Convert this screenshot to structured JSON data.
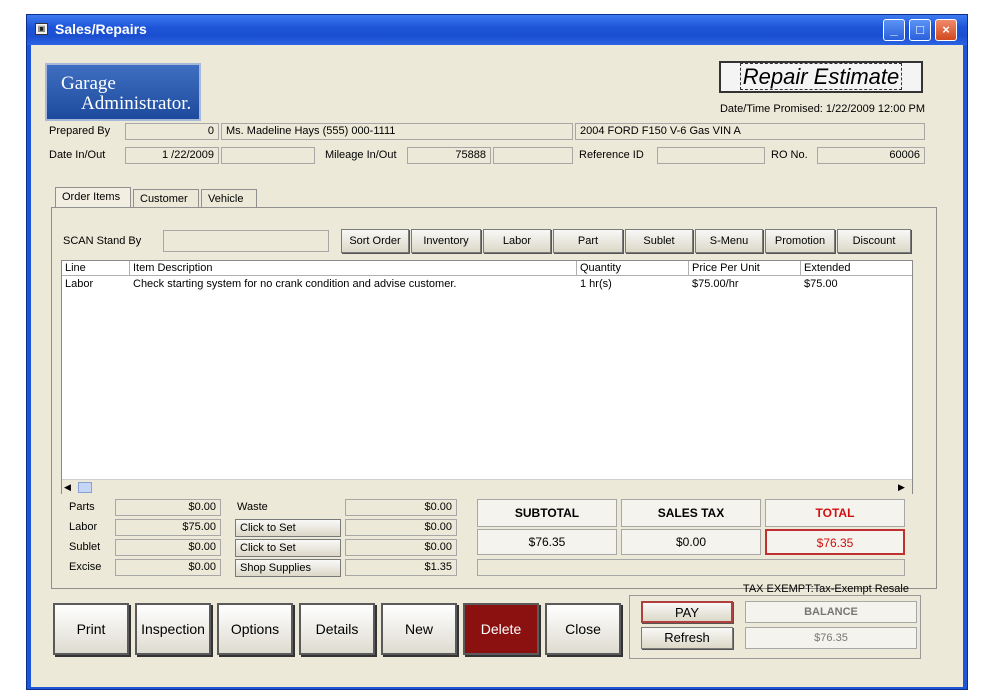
{
  "window": {
    "title": "Sales/Repairs",
    "min": "_",
    "max": "□",
    "close": "×",
    "icon": "app-icon"
  },
  "logo": {
    "line1": "Garage",
    "line2": "Administrator."
  },
  "estimate_label": "Repair Estimate",
  "promised": "Date/Time Promised: 1/22/2009 12:00 PM",
  "header": {
    "prepared_by_label": "Prepared By",
    "prepared_by_value": "0",
    "customer": "Ms. Madeline Hays (555) 000-1111",
    "vehicle": "2004 FORD F150  V-6 Gas VIN A",
    "date_label": "Date In/Out",
    "date_value": "1 /22/2009",
    "mileage_label": "Mileage In/Out",
    "mileage_value": "75888",
    "reference_label": "Reference ID",
    "ro_label": "RO No.",
    "ro_value": "60006"
  },
  "tabs": [
    "Order Items",
    "Customer",
    "Vehicle"
  ],
  "scan_label": "SCAN  Stand By",
  "toolbar": [
    "Sort Order",
    "Inventory",
    "Labor",
    "Part",
    "Sublet",
    "S-Menu",
    "Promotion",
    "Discount"
  ],
  "grid": {
    "columns": [
      "Line",
      "Item Description",
      "Quantity",
      "Price Per Unit",
      "Extended"
    ],
    "rows": [
      [
        "Labor",
        "Check starting system for no crank condition and advise customer.",
        "1 hr(s)",
        "$75.00/hr",
        "$75.00"
      ]
    ]
  },
  "costs": {
    "parts_label": "Parts",
    "parts": "$0.00",
    "labor_label": "Labor",
    "labor": "$75.00",
    "sublet_label": "Sublet",
    "sublet": "$0.00",
    "excise_label": "Excise",
    "excise": "$0.00",
    "waste_label": "Waste",
    "waste": "$0.00",
    "click1": "Click to Set",
    "click1_val": "$0.00",
    "click2": "Click to Set",
    "click2_val": "$0.00",
    "shop_label": "Shop Supplies",
    "shop": "$1.35"
  },
  "totals": {
    "subtotal_label": "SUBTOTAL",
    "subtotal": "$76.35",
    "tax_label": "SALES TAX",
    "tax": "$0.00",
    "total_label": "TOTAL",
    "total": "$76.35",
    "total_color": "#d01010"
  },
  "tax_exempt": "TAX EXEMPT:Tax-Exempt Resale",
  "actions": [
    "Print",
    "Inspection",
    "Options",
    "Details",
    "New",
    "Delete",
    "Close"
  ],
  "pay": {
    "pay_label": "PAY",
    "refresh_label": "Refresh",
    "balance_label": "BALANCE",
    "balance": "$76.35"
  }
}
